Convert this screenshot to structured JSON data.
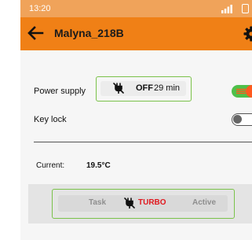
{
  "status_bar": {
    "time": "13:20",
    "signal_icon": "signal-bars-icon",
    "battery_icon": "battery-icon"
  },
  "app_bar": {
    "back_icon": "arrow-left-icon",
    "title": "Malyna_218B",
    "settings_icon": "gear-icon"
  },
  "power_supply": {
    "label": "Power supply",
    "icon": "plug-off-icon",
    "state": "OFF",
    "duration": "29 min",
    "toggle_on": true
  },
  "key_lock": {
    "label": "Key lock",
    "toggle_on": false
  },
  "current": {
    "label": "Current:",
    "value": "19.5°C"
  },
  "mode": {
    "task": "Task",
    "icon": "plug-off-icon",
    "turbo": "TURBO",
    "active": "Active"
  },
  "colors": {
    "status_bar": "#f0a35a",
    "app_bar": "#f08016",
    "highlight_border": "#7ac24a",
    "toggle_on": "#4fc04a",
    "toggle_knob": "#ff5a1f",
    "turbo": "#e0191f"
  }
}
